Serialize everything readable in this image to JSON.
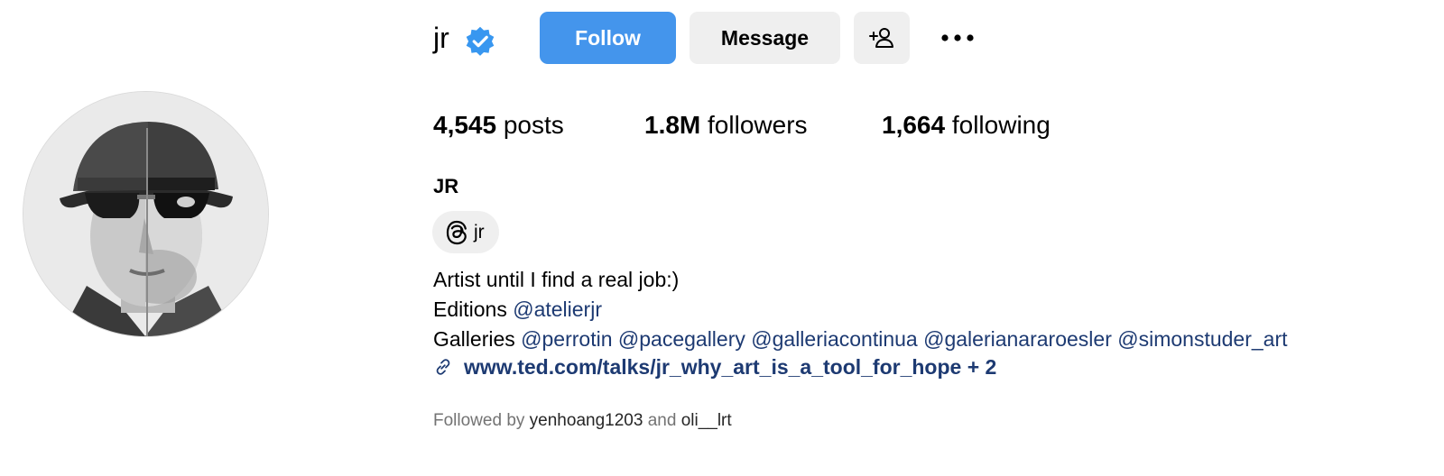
{
  "profile": {
    "username": "jr",
    "verified": true,
    "full_name": "JR"
  },
  "actions": {
    "follow_label": "Follow",
    "message_label": "Message",
    "add_user_icon": "add-person-icon",
    "more_icon": "more-options-icon"
  },
  "stats": {
    "posts_count": "4,545",
    "posts_label": "posts",
    "followers_count": "1.8M",
    "followers_label": "followers",
    "following_count": "1,664",
    "following_label": "following"
  },
  "threads": {
    "icon": "threads-icon",
    "handle": "jr"
  },
  "bio": {
    "line1": "Artist until I find a real job:)",
    "line2_prefix": "Editions",
    "line2_mentions": [
      "@atelierjr"
    ],
    "line3_prefix": "Galleries",
    "line3_mentions": [
      "@perrotin",
      "@pacegallery",
      "@galleriacontinua",
      "@galerianararoesler",
      "@simonstuder_art"
    ]
  },
  "link": {
    "icon": "link-icon",
    "text": "www.ted.com/talks/jr_why_art_is_a_tool_for_hope + 2"
  },
  "followed_by": {
    "prefix": "Followed by",
    "users": [
      "yenhoang1203",
      "oli__lrt"
    ],
    "joiner": "and"
  },
  "colors": {
    "follow_button": "#4495ec",
    "secondary_button": "#efefef",
    "mention": "#1d3a72",
    "verified_badge": "#3897f0"
  }
}
